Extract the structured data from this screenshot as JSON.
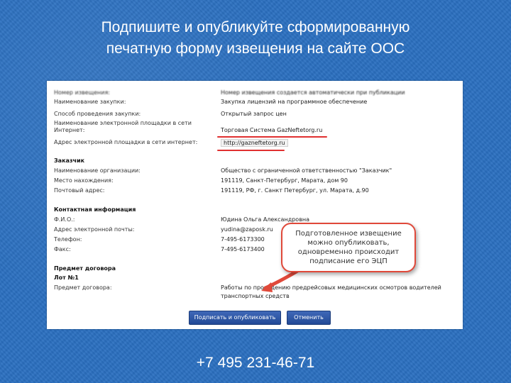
{
  "slide": {
    "title_line1": "Подпишите и опубликуйте сформированную",
    "title_line2": "печатную форму извещения на сайте ООС",
    "phone": "+7 495 231-46-71"
  },
  "form": {
    "rows_top": [
      {
        "label": "Номер извещения:",
        "value": "Номер извещения создается автоматически при публикации"
      },
      {
        "label": "Наименование закупки:",
        "value": "Закупка лицензий на программное обеспечение"
      },
      {
        "label": "Способ проведения закупки:",
        "value": "Открытый запрос цен"
      },
      {
        "label": "Наименование электронной площадки в сети",
        "value": ""
      },
      {
        "label": "Интернет:",
        "value": "Торговая Система GazNeftetorg.ru"
      },
      {
        "label": "Адрес электронной площадки в сети интернет:",
        "value": "http://gazneftetorg.ru"
      }
    ],
    "customer": {
      "section": "Заказчик",
      "rows": [
        {
          "label": "Наименование организации:",
          "value": "Общество с ограниченной ответственностью \"Заказчик\""
        },
        {
          "label": "Место нахождения:",
          "value": "191119, Санкт-Петербург, Марата, дом 90"
        },
        {
          "label": "Почтовый адрес:",
          "value": "191119, РФ, г. Санкт Петербург, ул. Марата, д.90"
        }
      ]
    },
    "contact": {
      "section": "Контактная информация",
      "rows": [
        {
          "label": "Ф.И.О.:",
          "value": "Юдина Ольга Александровна"
        },
        {
          "label": "Адрес электронной почты:",
          "value": "yudina@zaposk.ru"
        },
        {
          "label": "Телефон:",
          "value": "7-495-6173300"
        },
        {
          "label": "Факс:",
          "value": "7-495-6173400"
        }
      ]
    },
    "subject": {
      "section": "Предмет договора",
      "lot": "Лот №1",
      "rows": [
        {
          "label": "Предмет договора:",
          "value": "Работы по проведению предрейсовых медицинских осмотров водителей"
        },
        {
          "label": "",
          "value": "транспортных средств"
        }
      ]
    },
    "callout": "Подготовленное извещение можно опубликовать, одновременно происходит подписание его ЭЦП",
    "buttons": {
      "sign_publish": "Подписать и опубликовать",
      "cancel": "Отменить"
    }
  },
  "colors": {
    "background": "#2a6fc0",
    "button": "#2d57a8",
    "callout_border": "#e0493a",
    "underline": "#e03030"
  }
}
